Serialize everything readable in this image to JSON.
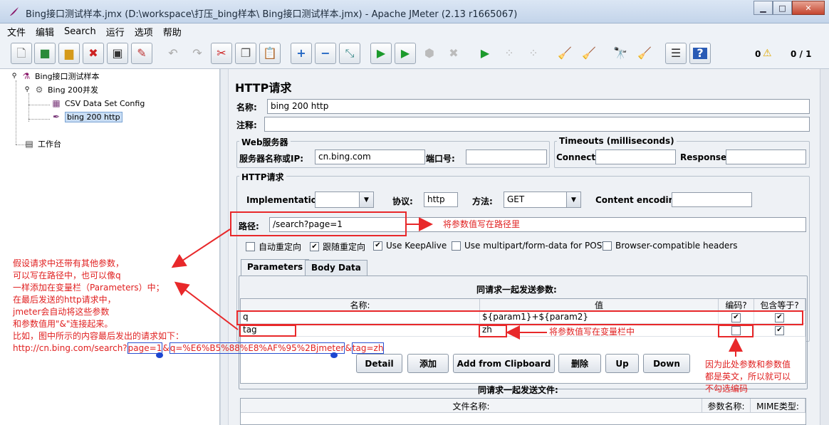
{
  "window": {
    "title": "Bing接口测试样本.jmx (D:\\workspace\\打压_bing样本\\ Bing接口测试样本.jmx) - Apache JMeter (2.13 r1665067)"
  },
  "menu": [
    "文件",
    "编辑",
    "Search",
    "运行",
    "选项",
    "帮助"
  ],
  "toolbar": {
    "warnings": "0",
    "threads": "0 / 1"
  },
  "tree": {
    "root": "Bing接口测试样本",
    "thread_group": "Bing 200并发",
    "csv": "CSV Data Set Config",
    "sampler": "bing 200 http",
    "workbench": "工作台"
  },
  "panel": {
    "title": "HTTP请求",
    "name_label": "名称:",
    "name_value": "bing 200 http",
    "comment_label": "注释:",
    "comment_value": "",
    "web_server": {
      "title": "Web服务器",
      "server_label": "服务器名称或IP:",
      "server_value": "cn.bing.com",
      "port_label": "端口号:",
      "port_value": ""
    },
    "timeouts": {
      "title": "Timeouts (milliseconds)",
      "connect_label": "Connect:",
      "response_label": "Response:"
    },
    "http_request": {
      "title": "HTTP请求",
      "impl_label": "Implementation:",
      "impl_value": "",
      "protocol_label": "协议:",
      "protocol_value": "http",
      "method_label": "方法:",
      "method_value": "GET",
      "encoding_label": "Content encoding:",
      "encoding_value": "",
      "path_label": "路径:",
      "path_value": "/search?page=1"
    },
    "options": {
      "auto_redirect": "自动重定向",
      "follow_redirect": "跟随重定向",
      "keepalive": "Use KeepAlive",
      "multipart": "Use multipart/form-data for POST",
      "browser_headers": "Browser-compatible headers"
    },
    "tabs": [
      "Parameters",
      "Body Data"
    ],
    "params": {
      "caption": "同请求一起发送参数:",
      "columns": [
        "名称:",
        "值",
        "编码?",
        "包含等于?"
      ],
      "rows": [
        {
          "name": "q",
          "value": "${param1}+${param2}",
          "encode": true,
          "include_equals": true
        },
        {
          "name": "tag",
          "value": "zh",
          "encode": false,
          "include_equals": true
        }
      ]
    },
    "buttons": [
      "Detail",
      "添加",
      "Add from Clipboard",
      "删除",
      "Up",
      "Down"
    ],
    "files": {
      "caption": "同请求一起发送文件:",
      "columns": [
        "文件名称:",
        "参数名称:",
        "MIME类型:"
      ]
    }
  },
  "annotations": {
    "path_note": "将参数值写在路径里",
    "var_note": "将参数值写在变量栏中",
    "encode_note": [
      "因为此处参数和参数值",
      "都是英文，所以就可以",
      "不勾选编码"
    ],
    "left_note": [
      "假设请求中还带有其他参数，",
      "可以写在路径中，也可以像q",
      "一样添加在变量栏（Parameters）中；",
      "在最后发送的http请求中，",
      "jmeter会自动将这些参数",
      "和参数值用\"&\"连接起来。",
      "比如，图中所示的内容最后发出的请求如下："
    ],
    "url_prefix": "http://cn.bing.com/search?",
    "url_part1": "page=1",
    "url_sep1": "&",
    "url_part2": "q=%E6%B5%88%E8%AF%95%2Bjmeter",
    "url_sep2": "&",
    "url_part3": "tag=zh"
  },
  "colors": {
    "annotation": "#e02020",
    "highlight_blue": "#2a4fd0"
  }
}
